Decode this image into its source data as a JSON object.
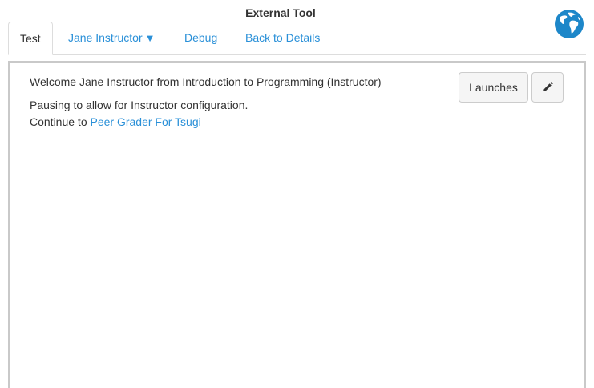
{
  "window": {
    "title": "External Tool"
  },
  "icons": {
    "globe": "globe-icon",
    "edit": "pencil-icon",
    "dropdown": "caret-down-icon"
  },
  "tabs": [
    {
      "label": "Test",
      "active": true
    },
    {
      "label": "Jane Instructor",
      "has_dropdown": true,
      "caret": "▼"
    },
    {
      "label": "Debug"
    },
    {
      "label": "Back to Details"
    }
  ],
  "main": {
    "welcome_text": "Welcome Jane Instructor from Introduction to Programming (Instructor)",
    "pause_text": "Pausing to allow for Instructor configuration.",
    "continue_prefix": "Continue to ",
    "continue_link": "Peer Grader For Tsugi",
    "launches_button": "Launches"
  },
  "colors": {
    "link": "#2a90d8",
    "globe_blue": "#1d87c9",
    "border": "#dddddd"
  }
}
